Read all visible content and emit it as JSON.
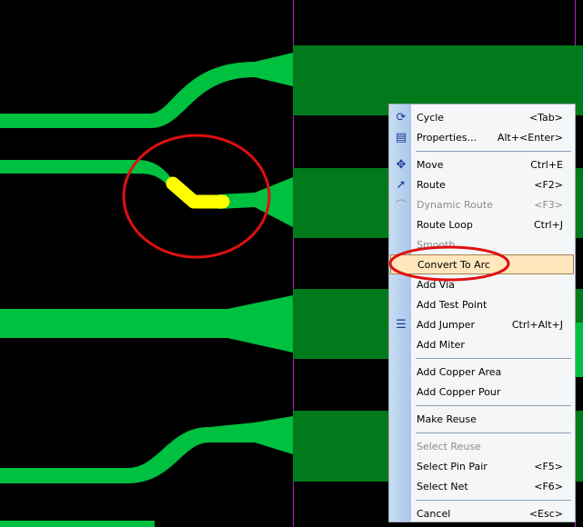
{
  "colors": {
    "pad": "#007a1a",
    "trace": "#00c040",
    "selected": "#ffff00",
    "annotation": "#e01010",
    "menu_highlight": "#ffe6bd"
  },
  "menu": {
    "items": [
      {
        "label": "Cycle",
        "shortcut": "<Tab>",
        "icon": "cycle-icon"
      },
      {
        "label": "Properties...",
        "shortcut": "Alt+<Enter>",
        "icon": "properties-icon"
      },
      {
        "label": "Move",
        "shortcut": "Ctrl+E",
        "icon": "move-icon"
      },
      {
        "label": "Route",
        "shortcut": "<F2>",
        "icon": "route-icon"
      },
      {
        "label": "Dynamic Route",
        "shortcut": "<F3>",
        "icon": "dynamic-route-icon",
        "disabled": true
      },
      {
        "label": "Route Loop",
        "shortcut": "Ctrl+J"
      },
      {
        "label": "Smooth",
        "disabled": true
      },
      {
        "label": "Convert To Arc",
        "highlighted": true
      },
      {
        "label": "Add Via"
      },
      {
        "label": "Add Test Point"
      },
      {
        "label": "Add Jumper",
        "shortcut": "Ctrl+Alt+J",
        "icon": "jumper-icon"
      },
      {
        "label": "Add Miter"
      },
      {
        "label": "Add Copper Area"
      },
      {
        "label": "Add Copper Pour"
      },
      {
        "label": "Make Reuse"
      },
      {
        "label": "Select Reuse",
        "disabled": true
      },
      {
        "label": "Select Pin Pair",
        "shortcut": "<F5>"
      },
      {
        "label": "Select Net",
        "shortcut": "<F6>"
      },
      {
        "label": "Cancel",
        "shortcut": "<Esc>"
      }
    ]
  }
}
